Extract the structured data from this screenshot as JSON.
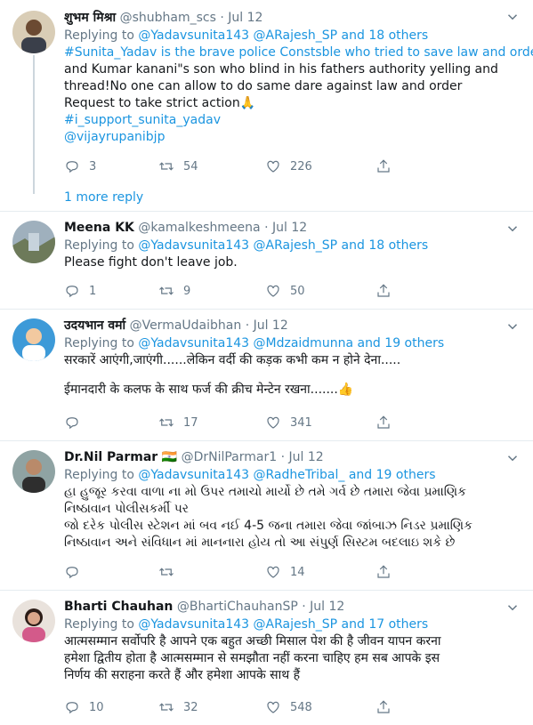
{
  "tweets": [
    {
      "name": "शुभम मिश्रा",
      "handle": "@shubham_scs",
      "date": "Jul 12",
      "replying_prefix": "Replying to",
      "replying_users": "@Yadavsunita143 @ARajesh_SP",
      "replying_and": "and",
      "replying_others": "18 others",
      "lines": [
        "#Sunita_Yadav is the brave police Constsble who tried to save law and order",
        "and Kumar kanani\"s son who blind in his fathers authority yelling and",
        "thread!No one can allow to do same dare against law and order",
        " Request to take strict action🙏",
        "#i_support_sunita_yadav",
        "@vijayrupanibjp"
      ],
      "replies": "3",
      "retweets": "54",
      "likes": "226",
      "more_replies": "1 more reply",
      "avatar_colors": [
        "#c9b79c",
        "#6b4a32"
      ]
    },
    {
      "name": "Meena KK",
      "handle": "@kamalkeshmeena",
      "date": "Jul 12",
      "replying_prefix": "Replying to",
      "replying_users": "@Yadavsunita143 @ARajesh_SP",
      "replying_and": "and",
      "replying_others": "18 others",
      "lines": [
        "Please fight don't leave job."
      ],
      "replies": "1",
      "retweets": "9",
      "likes": "50",
      "avatar_colors": [
        "#8a9aa6",
        "#5e6a52"
      ]
    },
    {
      "name": "उदयभान वर्मा",
      "handle": "@VermaUdaibhan",
      "date": "Jul 12",
      "replying_prefix": "Replying to",
      "replying_users": "@Yadavsunita143 @Mdzaidmunna",
      "replying_and": "and",
      "replying_others": "19 others",
      "lines": [
        "सरकारें आएंगी,जाएंगी......लेकिन वर्दी की कड़क कभी कम न होने देना.....",
        "",
        "ईमानदारी के कलफ के साथ फर्ज की क्रीच मेन्टेन रखना.......👍"
      ],
      "replies": "",
      "retweets": "17",
      "likes": "341",
      "avatar_colors": [
        "#2f8fd0",
        "#f2c9a0"
      ]
    },
    {
      "name": "Dr.Nil Parmar",
      "flag": "🇮🇳",
      "handle": "@DrNilParmar1",
      "date": "Jul 12",
      "replying_prefix": "Replying to",
      "replying_users": "@Yadavsunita143 @RadheTribal_",
      "replying_and": "and",
      "replying_others": "19 others",
      "lines": [
        "હા હુજૂર કરવા વાળા ના મો ઉપર તમાચો માર્યો છે તમે ગર્વ છે તમારા જેવા પ્રમાણિક",
        "નિષ્ઠાવાન પોલીસકર્મી પર",
        "જો દરેક પોલીસ સ્ટેશન માં બવ નઈ 4-5 જના તમારા જેવા જાંબાઝ નિડર પ્રમાણિક",
        "નિષ્ઠાવાન અને સંવિધાન માં માનનારા હોય તો આ સંપુર્ણ સિસ્ટમ બદલાઇ શકે છે"
      ],
      "replies": "",
      "retweets": "",
      "likes": "14",
      "avatar_colors": [
        "#7d8f8f",
        "#3b3b3b"
      ]
    },
    {
      "name": "Bharti Chauhan",
      "handle": "@BhartiChauhanSP",
      "date": "Jul 12",
      "replying_prefix": "Replying to",
      "replying_users": "@Yadavsunita143 @ARajesh_SP",
      "replying_and": "and",
      "replying_others": "17 others",
      "lines": [
        "आत्मसम्मान सर्वोपरि है आपने एक बहुत अच्छी मिसाल पेश की है जीवन यापन करना",
        "हमेशा द्वितीय होता है आत्मसम्मान से समझौता नहीं करना चाहिए हम सब आपके इस",
        "निर्णय की सराहना करते हैं और हमेशा आपके साथ हैं"
      ],
      "replies": "10",
      "retweets": "32",
      "likes": "548",
      "avatar_colors": [
        "#d35a8a",
        "#2b1c17"
      ]
    }
  ]
}
